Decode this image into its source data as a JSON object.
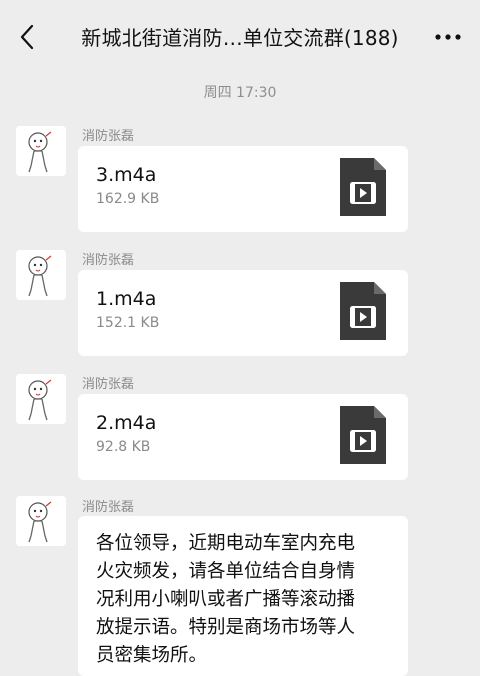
{
  "header": {
    "title": "新城北街道消防…单位交流群(188)"
  },
  "timestamp": "周四 17:30",
  "messages": [
    {
      "sender": "消防张磊",
      "file_name": "3.m4a",
      "file_size": "162.9 KB"
    },
    {
      "sender": "消防张磊",
      "file_name": "1.m4a",
      "file_size": "152.1 KB"
    },
    {
      "sender": "消防张磊",
      "file_name": "2.m4a",
      "file_size": "92.8 KB"
    },
    {
      "sender": "消防张磊",
      "lines": [
        "各位领导，近期电动车室内充电",
        "火灾频发，请各单位结合自身情",
        "况利用小喇叭或者广播等滚动播",
        "放提示语。特别是商场市场等人",
        "员密集场所。"
      ]
    }
  ],
  "icons": {
    "back": "chevron-left-icon",
    "more": "more-dots-icon",
    "file": "video-file-icon"
  },
  "colors": {
    "background": "#ededed",
    "bubble": "#ffffff",
    "file_icon": "#3a3a3a"
  }
}
